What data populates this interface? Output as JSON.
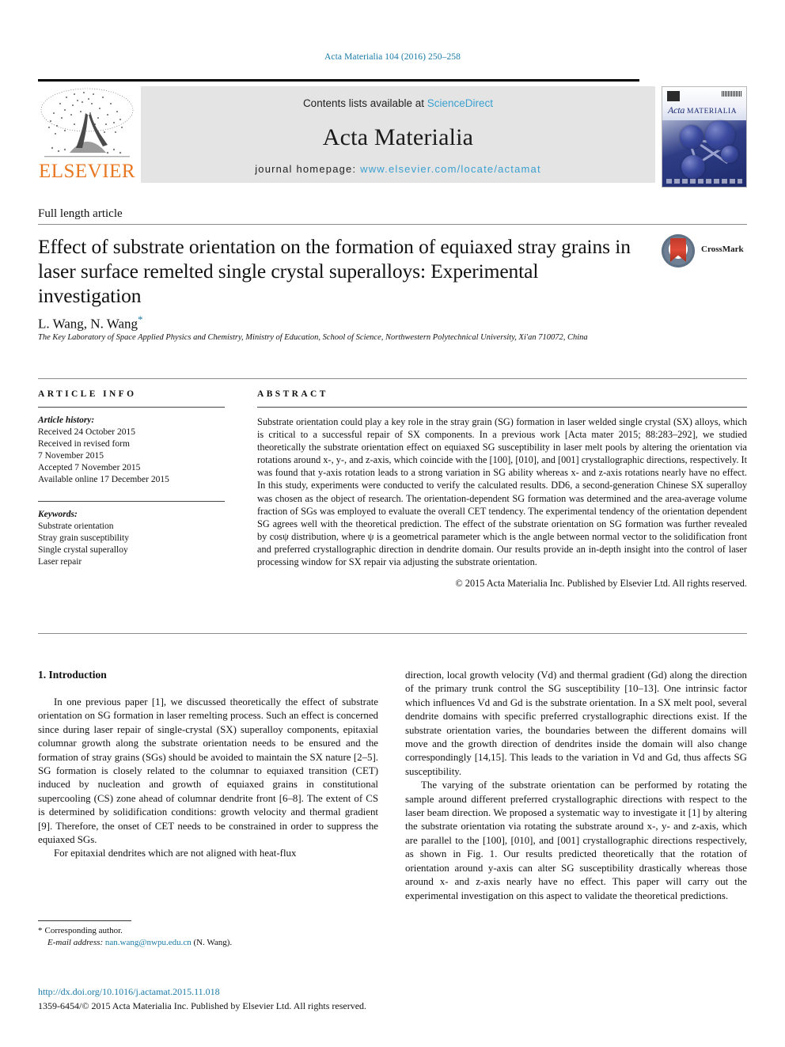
{
  "running_head": "Acta Materialia 104 (2016) 250–258",
  "masthead": {
    "publisher_logo_label": "ELSEVIER",
    "contents_prefix": "Contents lists available at ",
    "contents_link": "ScienceDirect",
    "journal_title": "Acta Materialia",
    "homepage_prefix": "journal homepage: ",
    "homepage_url": "www.elsevier.com/locate/actamat",
    "cover_journal_name_italic": "Acta",
    "cover_journal_name_caps": "MATERIALIA"
  },
  "article": {
    "type": "Full length article",
    "title": "Effect of substrate orientation on the formation of equiaxed stray grains in laser surface remelted single crystal superalloys: Experimental investigation",
    "authors": "L. Wang, N. Wang",
    "corresponding_marker": "*",
    "affiliation": "The Key Laboratory of Space Applied Physics and Chemistry, Ministry of Education, School of Science, Northwestern Polytechnical University, Xi'an 710072, China",
    "crossmark_label": "CrossMark"
  },
  "info": {
    "heading": "ARTICLE INFO",
    "history_label": "Article history:",
    "history": [
      "Received 24 October 2015",
      "Received in revised form",
      "7 November 2015",
      "Accepted 7 November 2015",
      "Available online 17 December 2015"
    ],
    "keywords_label": "Keywords:",
    "keywords": [
      "Substrate orientation",
      "Stray grain susceptibility",
      "Single crystal superalloy",
      "Laser repair"
    ]
  },
  "abstract": {
    "heading": "ABSTRACT",
    "text": "Substrate orientation could play a key role in the stray grain (SG) formation in laser welded single crystal (SX) alloys, which is critical to a successful repair of SX components. In a previous work [Acta mater 2015; 88:283–292], we studied theoretically the substrate orientation effect on equiaxed SG susceptibility in laser melt pools by altering the orientation via rotations around x-, y-, and z-axis, which coincide with the [100], [010], and [001] crystallographic directions, respectively. It was found that y-axis rotation leads to a strong variation in SG ability whereas x- and z-axis rotations nearly have no effect. In this study, experiments were conducted to verify the calculated results. DD6, a second-generation Chinese SX superalloy was chosen as the object of research. The orientation-dependent SG formation was determined and the area-average volume fraction of SGs was employed to evaluate the overall CET tendency. The experimental tendency of the orientation dependent SG agrees well with the theoretical prediction. The effect of the substrate orientation on SG formation was further revealed by cosψ distribution, where ψ is a geometrical parameter which is the angle between normal vector to the solidification front and preferred crystallographic direction in dendrite domain. Our results provide an in-depth insight into the control of laser processing window for SX repair via adjusting the substrate orientation.",
    "copyright": "© 2015 Acta Materialia Inc. Published by Elsevier Ltd. All rights reserved."
  },
  "body": {
    "section_heading": "1. Introduction",
    "left_paragraphs": [
      "In one previous paper [1], we discussed theoretically the effect of substrate orientation on SG formation in laser remelting process. Such an effect is concerned since during laser repair of single-crystal (SX) superalloy components, epitaxial columnar growth along the substrate orientation needs to be ensured and the formation of stray grains (SGs) should be avoided to maintain the SX nature [2–5]. SG formation is closely related to the columnar to equiaxed transition (CET) induced by nucleation and growth of equiaxed grains in constitutional supercooling (CS) zone ahead of columnar dendrite front [6–8]. The extent of CS is determined by solidification conditions: growth velocity and thermal gradient [9]. Therefore, the onset of CET needs to be constrained in order to suppress the equiaxed SGs.",
      "For epitaxial dendrites which are not aligned with heat-flux"
    ],
    "right_paragraphs": [
      "direction, local growth velocity (Vd) and thermal gradient (Gd) along the direction of the primary trunk control the SG susceptibility [10–13]. One intrinsic factor which influences Vd and Gd is the substrate orientation. In a SX melt pool, several dendrite domains with specific preferred crystallographic directions exist. If the substrate orientation varies, the boundaries between the different domains will move and the growth direction of dendrites inside the domain will also change correspondingly [14,15]. This leads to the variation in Vd and Gd, thus affects SG susceptibility.",
      "The varying of the substrate orientation can be performed by rotating the sample around different preferred crystallographic directions with respect to the laser beam direction. We proposed a systematic way to investigate it [1] by altering the substrate orientation via rotating the substrate around x-, y- and z-axis, which are parallel to the [100], [010], and [001] crystallographic directions respectively, as shown in Fig. 1. Our results predicted theoretically that the rotation of orientation around y-axis can alter SG susceptibility drastically whereas those around x- and z-axis nearly have no effect. This paper will carry out the experimental investigation on this aspect to validate the theoretical predictions."
    ],
    "references_inline": [
      "[1]",
      "[2–5]",
      "[6–8]",
      "[9]",
      "[10–13]",
      "[14,15]",
      "Fig. 1"
    ]
  },
  "footer": {
    "corresponding_marker": "*",
    "corresponding_label": "Corresponding author.",
    "email_label": "E-mail address:",
    "email": "nan.wang@nwpu.edu.cn",
    "email_suffix": "(N. Wang).",
    "doi": "http://dx.doi.org/10.1016/j.actamat.2015.11.018",
    "issn_line": "1359-6454/© 2015 Acta Materialia Inc. Published by Elsevier Ltd. All rights reserved."
  },
  "colors": {
    "link": "#1a7aa8",
    "science_direct": "#3aa0d0",
    "elsevier_orange": "#E87722",
    "banner_bg": "#e4e4e4"
  }
}
